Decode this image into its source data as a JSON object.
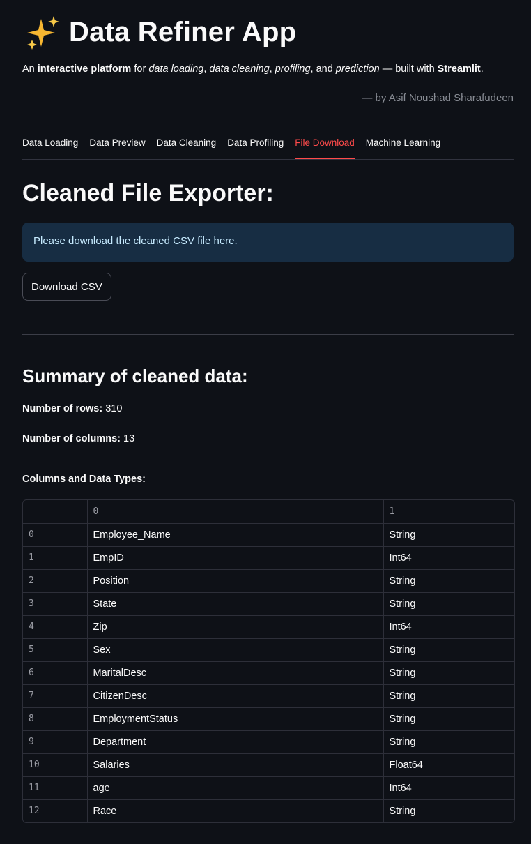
{
  "header": {
    "title": "Data Refiner App",
    "icon": "sparkles-icon",
    "tagline": {
      "a": "An ",
      "b": "interactive platform",
      "c": " for ",
      "d": "data loading",
      "e": ", ",
      "f": "data cleaning",
      "g": ", ",
      "h": "profiling",
      "i": ", and ",
      "j": "prediction",
      "k": " — built with ",
      "l": "Streamlit",
      "m": "."
    },
    "byline": "— by Asif Noushad Sharafudeen"
  },
  "tabs": [
    {
      "label": "Data Loading",
      "active": false
    },
    {
      "label": "Data Preview",
      "active": false
    },
    {
      "label": "Data Cleaning",
      "active": false
    },
    {
      "label": "Data Profiling",
      "active": false
    },
    {
      "label": "File Download",
      "active": true
    },
    {
      "label": "Machine Learning",
      "active": false
    }
  ],
  "exporter": {
    "title": "Cleaned File Exporter:",
    "info": "Please download the cleaned CSV file here.",
    "button_label": "Download CSV"
  },
  "summary": {
    "title": "Summary of cleaned data:",
    "rows_label": "Number of rows:",
    "rows_value": " 310",
    "cols_label": "Number of columns:",
    "cols_value": " 13",
    "types_heading": "Columns and Data Types:"
  },
  "table": {
    "headers": [
      "",
      "0",
      "1"
    ],
    "rows": [
      [
        "0",
        "Employee_Name",
        "String"
      ],
      [
        "1",
        "EmpID",
        "Int64"
      ],
      [
        "2",
        "Position",
        "String"
      ],
      [
        "3",
        "State",
        "String"
      ],
      [
        "4",
        "Zip",
        "Int64"
      ],
      [
        "5",
        "Sex",
        "String"
      ],
      [
        "6",
        "MaritalDesc",
        "String"
      ],
      [
        "7",
        "CitizenDesc",
        "String"
      ],
      [
        "8",
        "EmploymentStatus",
        "String"
      ],
      [
        "9",
        "Department",
        "String"
      ],
      [
        "10",
        "Salaries",
        "Float64"
      ],
      [
        "11",
        "age",
        "Int64"
      ],
      [
        "12",
        "Race",
        "String"
      ]
    ]
  },
  "colors": {
    "background": "#0e1117",
    "accent": "#ff4b4b",
    "info_bg": "#172d43",
    "info_text": "#c7ebff"
  }
}
